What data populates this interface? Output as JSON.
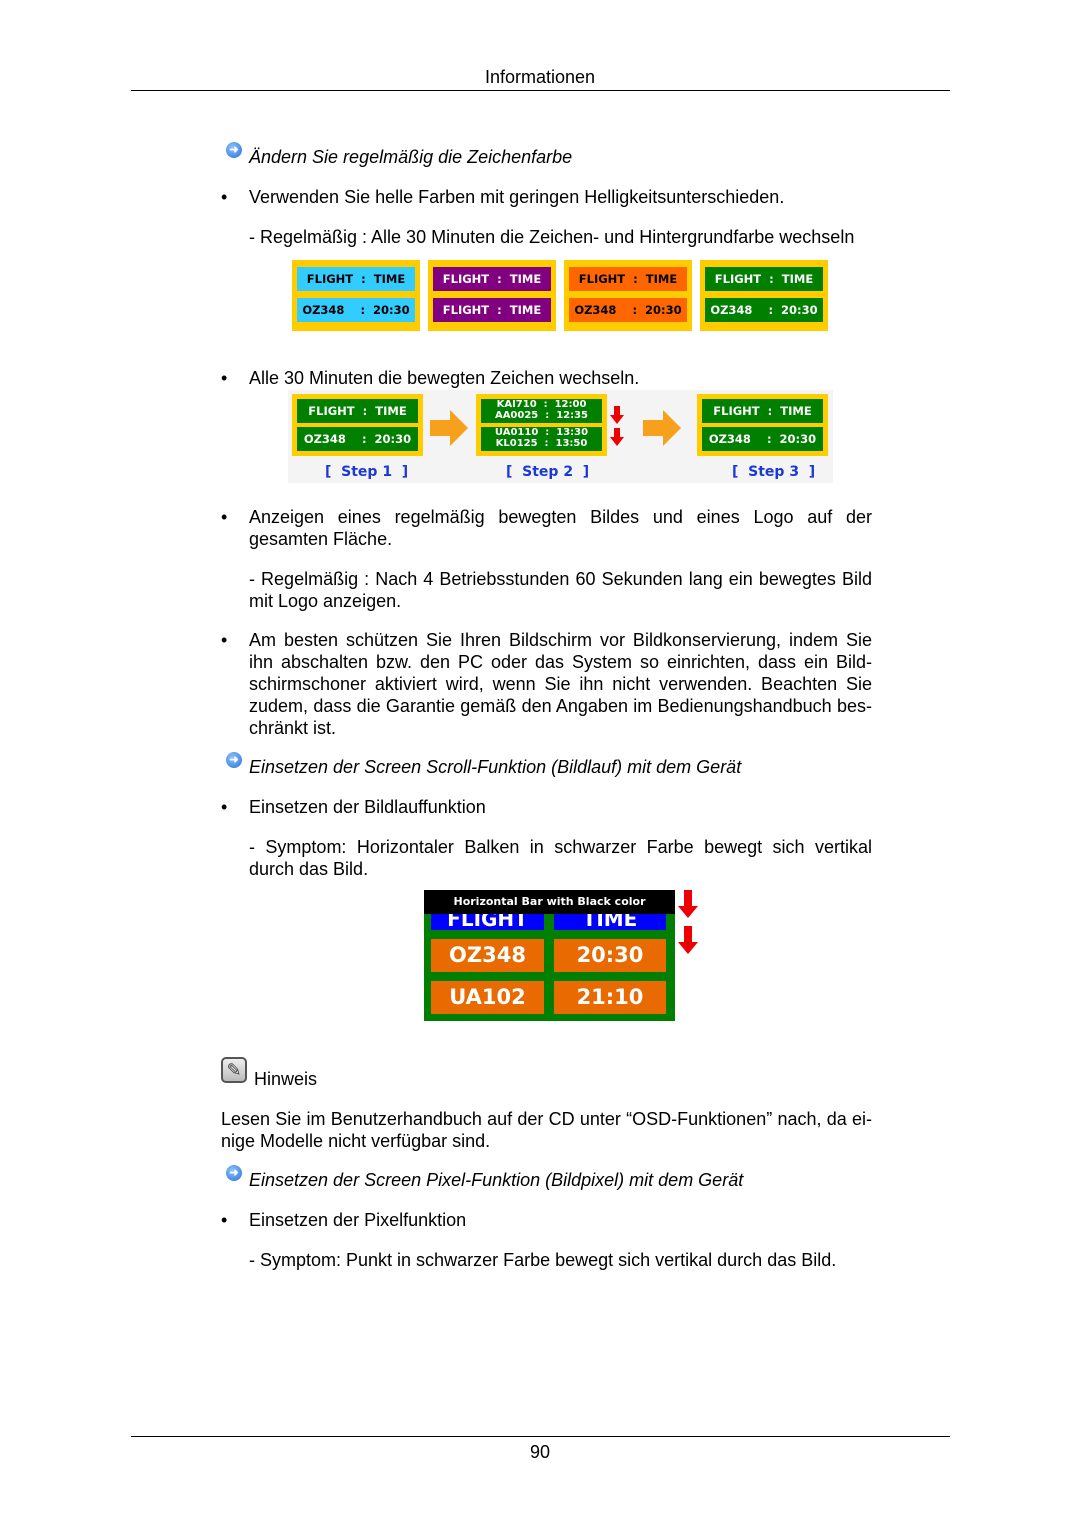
{
  "header": {
    "title": "Informationen"
  },
  "sections": [
    {
      "heading": "Ändern Sie regelmäßig die Zeichenfarbe"
    },
    {
      "heading": "Einsetzen der Screen Scroll-Funktion (Bildlauf) mit dem Gerät"
    },
    {
      "heading": "Einsetzen der Screen Pixel-Funktion (Bildpixel) mit dem Gerät"
    }
  ],
  "bullet_char": "•",
  "texts": {
    "b1": "Verwenden Sie helle Farben mit geringen Helligkeitsunterschieden.",
    "s1": "- Regelmäßig : Alle 30 Minuten die Zeichen- und Hintergrundfarbe wechseln",
    "b2": "Alle 30 Minuten die bewegten Zeichen wechseln.",
    "b3": "Anzeigen eines regelmäßig bewegten Bildes und eines Logo auf der gesamten Fläche.",
    "s3": "- Regelmäßig : Nach 4 Betriebsstunden 60 Sekunden lang ein bewegtes Bild mit Logo anzeigen.",
    "b4": "Am besten schützen Sie Ihren Bildschirm vor Bildkonservierung, indem Sie ihn abschalten bzw. den PC oder das System so einrichten, dass ein Bild­schirmschoner aktiviert wird, wenn Sie ihn nicht verwenden. Beachten Sie zudem, dass die Garantie gemäß den Angaben im Bedienungshandbuch bes­chränkt ist.",
    "b5": "Einsetzen der Bildlauffunktion",
    "s5": "- Symptom: Horizontaler Balken in schwarzer Farbe bewegt sich vertikal durch das Bild.",
    "b6": "Einsetzen der Pixelfunktion",
    "s6": "- Symptom: Punkt in schwarzer Farbe bewegt sich vertikal durch das Bild."
  },
  "color_panels": [
    {
      "top": "FLIGHT  :  TIME",
      "bottom": "OZ348    :  20:30",
      "bg": "#33ccff",
      "fg": "#000000"
    },
    {
      "top": "FLIGHT  :  TIME",
      "bottom": "FLIGHT  :  TIME",
      "bg": "#800080",
      "fg": "#ffffff"
    },
    {
      "top": "FLIGHT  :  TIME",
      "bottom": "OZ348    :  20:30",
      "bg": "#ff6600",
      "fg": "#000000"
    },
    {
      "top": "FLIGHT  :  TIME",
      "bottom": "OZ348    :  20:30",
      "bg": "#007f00",
      "fg": "#ffffff"
    }
  ],
  "steps": [
    {
      "label": "[  Step 1  ]",
      "top": "FLIGHT  :  TIME",
      "bottom": "OZ348    :  20:30"
    },
    {
      "label": "[  Step 2  ]",
      "top": "KAI710  :  12:00\nAA0025  :  12:35",
      "bottom": "UA0110  :  13:30\nKL0125  :  13:50"
    },
    {
      "label": "[  Step 3  ]",
      "top": "FLIGHT  :  TIME",
      "bottom": "OZ348    :  20:30"
    }
  ],
  "scroll_demo": {
    "bar_label": "Horizontal Bar with Black color",
    "header": [
      "FLIGHT",
      "TIME"
    ],
    "rows": [
      [
        "OZ348",
        "20:30"
      ],
      [
        "UA102",
        "21:10"
      ]
    ]
  },
  "note": {
    "title": "Hinweis",
    "text": "Lesen Sie im Benutzerhandbuch auf der CD unter “OSD-Funktionen” nach, da ei­nige Modelle nicht verfügbar sind."
  },
  "footer": {
    "page": "90"
  }
}
